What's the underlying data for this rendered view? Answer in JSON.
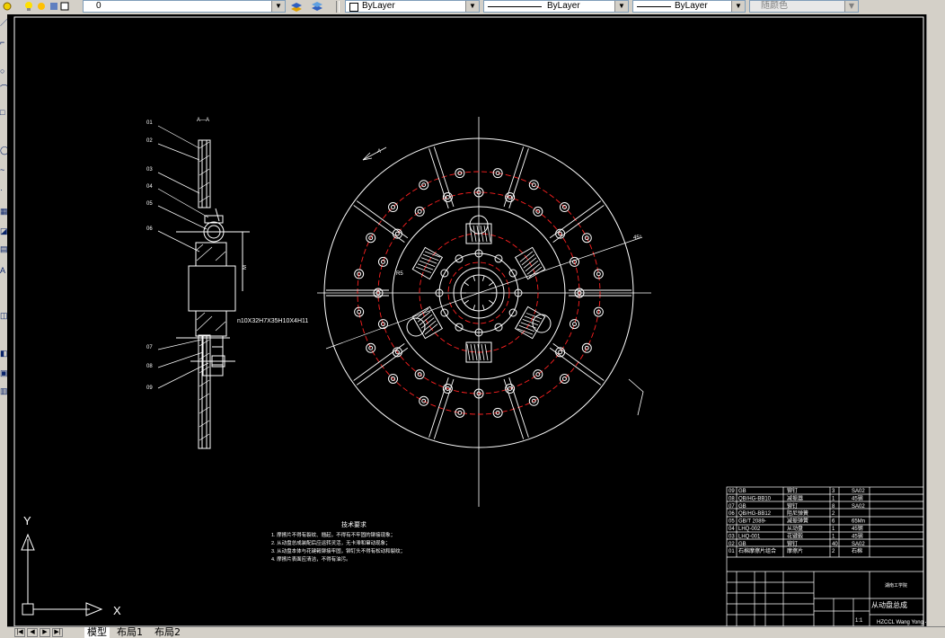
{
  "toolbar": {
    "layer_value": "0",
    "color_value": "ByLayer",
    "linetype_value": "ByLayer",
    "lineweight_value": "ByLayer",
    "plotstyle_value": "随颜色"
  },
  "drawing": {
    "section_label": "A—A",
    "view_marker": "A",
    "spline_note": "n10X32H7X35H10X4H11",
    "dim_vertical": "M",
    "dim_angle": "45°",
    "dim_radius": "R5",
    "ucs_y": "Y",
    "ucs_x": "X",
    "callouts": [
      "01",
      "02",
      "03",
      "04",
      "05",
      "06",
      "07",
      "08",
      "09"
    ],
    "tech_title": "技术要求",
    "tech_lines": [
      "1. 摩擦片不得有裂纹、翘起，不得有不牢固的铆接现象；",
      "2. 从动盘总成装配后应运转灵活，无卡滞和窜动现象；",
      "3. 从动盘本体与花键毂铆接牢固，铆钉头不得有松动和裂纹；",
      "4. 摩擦片表面应清洁，不得有油污。"
    ]
  },
  "title_block": {
    "bom_rows": [
      {
        "no": "09",
        "code": "GB",
        "name": "铆钉",
        "qty": "3",
        "mat": "SA02"
      },
      {
        "no": "08",
        "code": "QB/HG-BB10",
        "name": "减振器",
        "qty": "1",
        "mat": "45钢"
      },
      {
        "no": "07",
        "code": "GB",
        "name": "铆钉",
        "qty": "8",
        "mat": "SA02"
      },
      {
        "no": "06",
        "code": "QB/HG-BB12",
        "name": "阻尼弹簧",
        "qty": "2",
        "mat": ""
      },
      {
        "no": "05",
        "code": "GB/T 2089-",
        "name": "减振弹簧",
        "qty": "6",
        "mat": "65Mn"
      },
      {
        "no": "04",
        "code": "LHQ-002",
        "name": "从动盘",
        "qty": "1",
        "mat": "45钢"
      },
      {
        "no": "03",
        "code": "LHQ-001",
        "name": "花键毂",
        "qty": "1",
        "mat": "45钢"
      },
      {
        "no": "02",
        "code": "GB",
        "name": "铆钉",
        "qty": "40",
        "mat": "SA02"
      },
      {
        "no": "01",
        "code": "石棉摩擦片组合",
        "name": "摩擦片",
        "qty": "2",
        "mat": "石棉"
      }
    ],
    "school": "湖南工学院",
    "drawing_name": "从动盘总成",
    "author": "HZCCL Wang Yong - B",
    "scale": "1:1"
  },
  "tabs": {
    "model": "模型",
    "layout1": "布局1",
    "layout2": "布局2"
  }
}
